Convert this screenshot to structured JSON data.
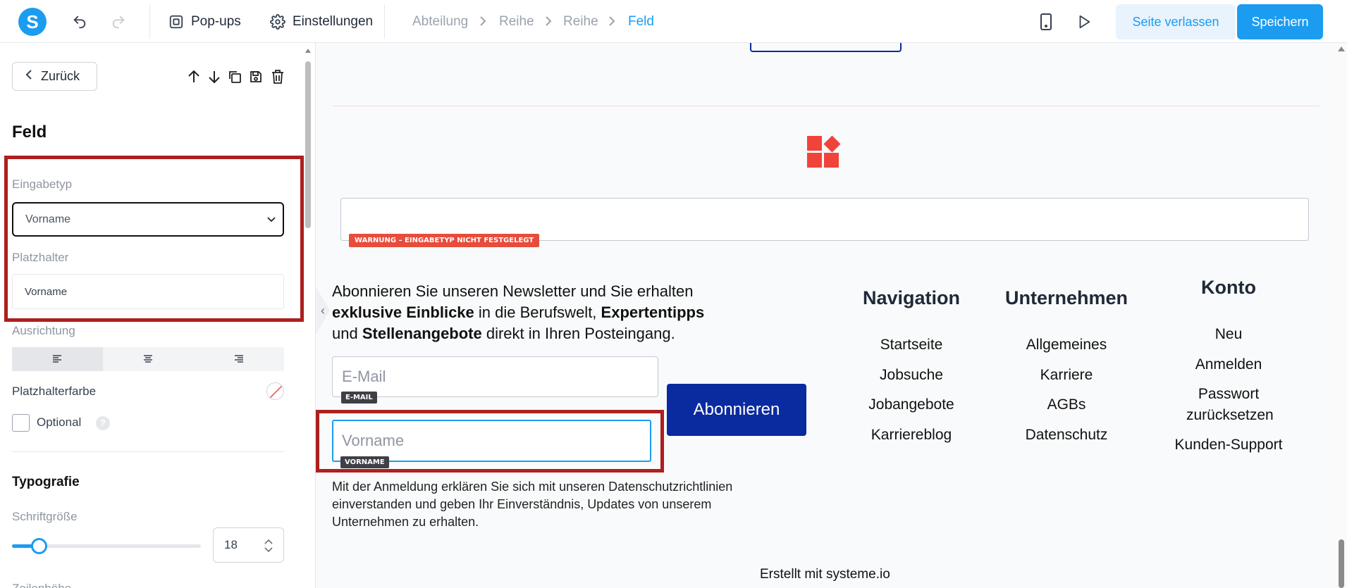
{
  "topbar": {
    "logo": "S",
    "popups_label": "Pop-ups",
    "settings_label": "Einstellungen",
    "breadcrumb": [
      "Abteilung",
      "Reihe",
      "Reihe",
      "Feld"
    ],
    "leave_label": "Seite verlassen",
    "save_label": "Speichern"
  },
  "sidebar": {
    "back_label": "Zurück",
    "title": "Feld",
    "input_type_label": "Eingabetyp",
    "input_type_value": "Vorname",
    "placeholder_label": "Platzhalter",
    "placeholder_value": "Vorname",
    "alignment_label": "Ausrichtung",
    "placeholder_color_label": "Platzhalterfarbe",
    "optional_label": "Optional",
    "help_icon_glyph": "?",
    "typography_title": "Typografie",
    "font_size_label": "Schriftgröße",
    "font_size_value": "18",
    "line_height_label": "Zeilenhöhe"
  },
  "canvas": {
    "warning_badge": "WARNUNG – EINGABETYP NICHT FESTGELEGT",
    "newsletter_parts": [
      {
        "text": "Abonnieren Sie unseren Newsletter und Sie erhalten ",
        "bold": false
      },
      {
        "text": "exklusive Einblicke",
        "bold": true
      },
      {
        "text": " in die Berufswelt, ",
        "bold": false
      },
      {
        "text": "Expertentipps",
        "bold": true
      },
      {
        "text": " und ",
        "bold": false
      },
      {
        "text": "Stellenangebote",
        "bold": true
      },
      {
        "text": " direkt in Ihren Posteingang.",
        "bold": false
      }
    ],
    "email_placeholder": "E-Mail",
    "email_tag": "E-MAIL",
    "firstname_placeholder": "Vorname",
    "firstname_tag": "VORNAME",
    "subscribe_label": "Abonnieren",
    "consent_text": "Mit der Anmeldung erklären Sie sich mit unseren Datenschutzrichtlinien einverstanden und geben Ihr Einverständnis, Updates von unserem Unternehmen zu erhalten.",
    "nav_heading": "Navigation",
    "nav_items": [
      "Startseite",
      "Jobsuche",
      "Jobangebote",
      "Karriereblog"
    ],
    "company_heading": "Unternehmen",
    "company_items": [
      "Allgemeines",
      "Karriere",
      "AGBs",
      "Datenschutz"
    ],
    "account_heading": "Konto",
    "account_items": [
      "Neu",
      "Anmelden",
      "Passwort zurücksetzen",
      "Kunden-Support"
    ],
    "footer_note": "Erstellt mit systeme.io"
  },
  "colors": {
    "accent": "#1c9cf0",
    "brand_button": "#0a2aa0",
    "logo_red": "#f0443a",
    "highlight": "#ad1f1f",
    "warning": "#e74c3c"
  },
  "icons": {
    "logo": "systeme-logo",
    "undo": "undo-icon",
    "redo": "redo-icon",
    "popups": "popup-icon",
    "settings": "gear-icon",
    "mobile": "mobile-icon",
    "preview": "play-icon",
    "back": "chevron-left-icon",
    "move_up": "arrow-up-icon",
    "move_down": "arrow-down-icon",
    "duplicate": "copy-icon",
    "save_block": "floppy-icon",
    "delete": "trash-icon",
    "placeholder_color": "no-color-icon"
  }
}
